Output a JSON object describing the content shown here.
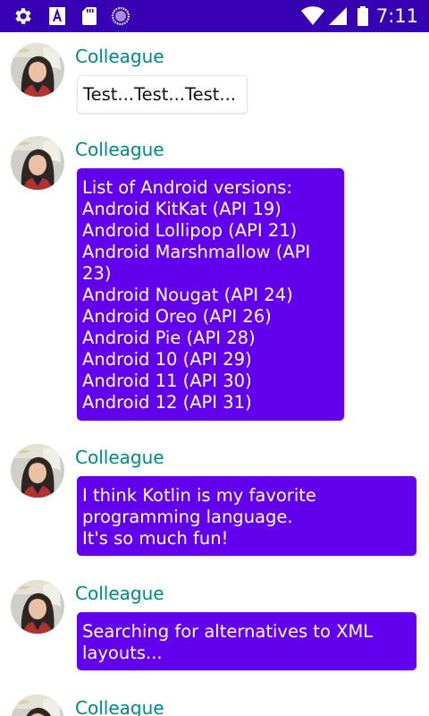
{
  "status_bar": {
    "time": "7:11",
    "icons": [
      "gear-icon",
      "font-a-icon",
      "sd-card-icon",
      "circle-spinner-icon",
      "wifi-icon",
      "cellular-signal-icon",
      "battery-icon"
    ],
    "color": "#3700b3"
  },
  "colors": {
    "author": "#018786",
    "bubble_fill": "#6200ee",
    "bubble_text": "#ffffff"
  },
  "messages": [
    {
      "author": "Colleague",
      "text": "Test...Test...Test...",
      "style": "outlined"
    },
    {
      "author": "Colleague",
      "text": "List of Android versions:\nAndroid KitKat (API 19)\nAndroid Lollipop (API 21)\nAndroid Marshmallow (API 23)\nAndroid Nougat (API 24)\nAndroid Oreo (API 26)\nAndroid Pie (API 28)\nAndroid 10 (API 29)\nAndroid 11 (API 30)\nAndroid 12 (API 31)\n",
      "style": "filled"
    },
    {
      "author": "Colleague",
      "text": "I think Kotlin is my favorite programming language.\nIt's so much fun!",
      "style": "filled"
    },
    {
      "author": "Colleague",
      "text": "Searching for alternatives to XML layouts...",
      "style": "filled"
    },
    {
      "author": "Colleague",
      "text": "",
      "style": "filled"
    }
  ]
}
